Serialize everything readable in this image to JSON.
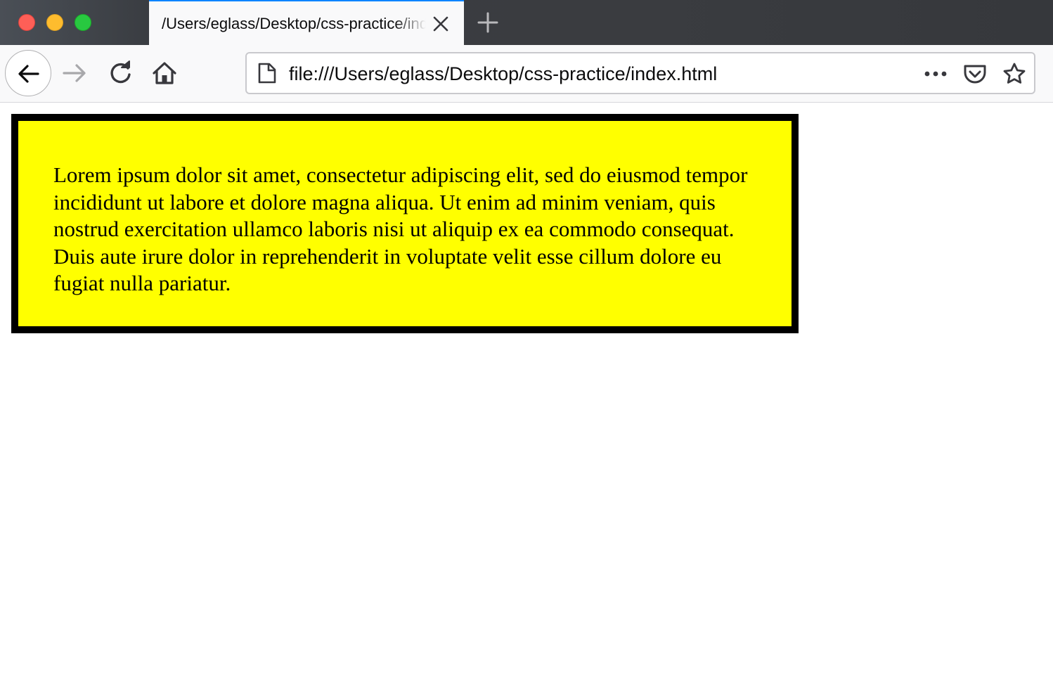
{
  "tab": {
    "title": "/Users/eglass/Desktop/css-practice/index.html",
    "close_icon": "close-icon",
    "new_tab_icon": "plus-icon"
  },
  "window_controls": {
    "close_color": "#fe5f57",
    "minimize_color": "#febc2e",
    "zoom_color": "#28c840"
  },
  "toolbar": {
    "back_icon": "arrow-left-icon",
    "forward_icon": "arrow-right-icon",
    "reload_icon": "reload-icon",
    "home_icon": "home-icon"
  },
  "urlbar": {
    "url": "file:///Users/eglass/Desktop/css-practice/index.html",
    "page_icon": "page-icon",
    "more_icon": "ellipsis-icon",
    "pocket_icon": "pocket-icon",
    "bookmark_icon": "star-icon"
  },
  "page": {
    "paragraph": "Lorem ipsum dolor sit amet, consectetur adipiscing elit, sed do eiusmod tempor incididunt ut labore et dolore magna aliqua. Ut enim ad minim veniam, quis nostrud exercitation ullamco laboris nisi ut aliquip ex ea commodo consequat. Duis aute irure dolor in reprehenderit in voluptate velit esse cillum dolore eu fugiat nulla pariatur.",
    "box_background": "#ffff00",
    "box_border_color": "#000000"
  }
}
